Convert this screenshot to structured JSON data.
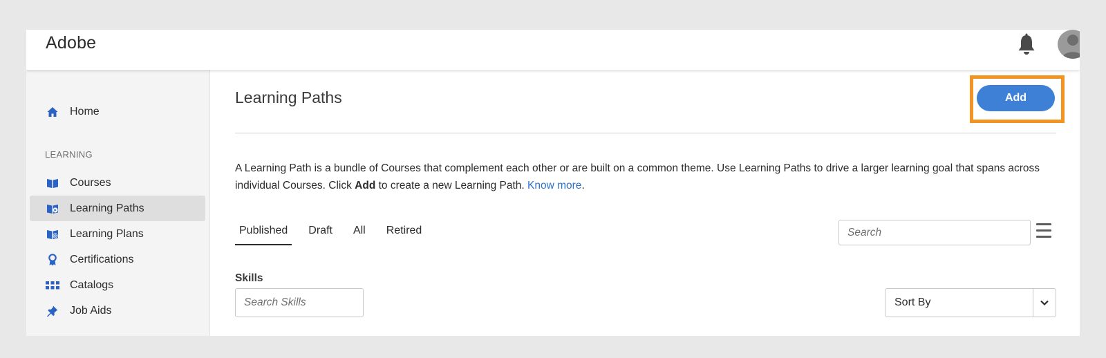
{
  "brand": "Adobe",
  "header": {
    "bell_icon": "bell-icon",
    "avatar_icon": "user-avatar-icon"
  },
  "sidebar": {
    "home": {
      "label": "Home",
      "icon": "home-icon"
    },
    "section_label": "LEARNING",
    "items": [
      {
        "label": "Courses",
        "icon": "book-icon"
      },
      {
        "label": "Learning Paths",
        "icon": "learning-path-icon",
        "active": true
      },
      {
        "label": "Learning Plans",
        "icon": "learning-plan-icon"
      },
      {
        "label": "Certifications",
        "icon": "certificate-icon"
      },
      {
        "label": "Catalogs",
        "icon": "grid-icon"
      },
      {
        "label": "Job Aids",
        "icon": "pin-icon"
      }
    ]
  },
  "main": {
    "title": "Learning Paths",
    "add_label": "Add",
    "description": {
      "part1": "A Learning Path is a bundle of Courses that complement each other or are built on a common theme. Use Learning Paths to drive a larger learning goal that spans across individual Courses. Click ",
      "bold": "Add",
      "part2": " to create a new Learning Path. ",
      "link": "Know more",
      "end": "."
    },
    "tabs": [
      "Published",
      "Draft",
      "All",
      "Retired"
    ],
    "active_tab": "Published",
    "search_placeholder": "Search",
    "skills_label": "Skills",
    "skills_placeholder": "Search Skills",
    "sort_label": "Sort By"
  },
  "colors": {
    "accent": "#3d80d6",
    "highlight": "#f29423",
    "icon_blue": "#2a63c4"
  }
}
